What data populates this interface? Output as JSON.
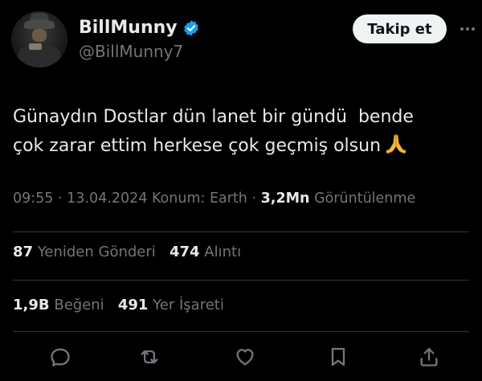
{
  "user": {
    "display_name": "BillMunny",
    "handle": "@BillMunny7",
    "verified": true,
    "follow_label": "Takip et"
  },
  "tweet": {
    "line1": "Günaydın Dostlar dün lanet bir gündü  bende",
    "line2": "çok zarar ettim herkese çok geçmiş olsun",
    "emoji": "pray-icon"
  },
  "meta": {
    "time": "09:55",
    "date": "13.04.2024",
    "location_label": "Konum: Earth",
    "views_count": "3,2Mn",
    "views_label": "Görüntülenme",
    "sep": "·"
  },
  "stats": {
    "reposts_count": "87",
    "reposts_label": "Yeniden Gönderi",
    "quotes_count": "474",
    "quotes_label": "Alıntı",
    "likes_count": "1,9B",
    "likes_label": "Beğeni",
    "bookmarks_count": "491",
    "bookmarks_label": "Yer İşareti"
  },
  "colors": {
    "background": "#000000",
    "text": "#e7e9ea",
    "muted": "#71767b",
    "verified": "#1d9bf0",
    "divider": "#2f3336"
  }
}
